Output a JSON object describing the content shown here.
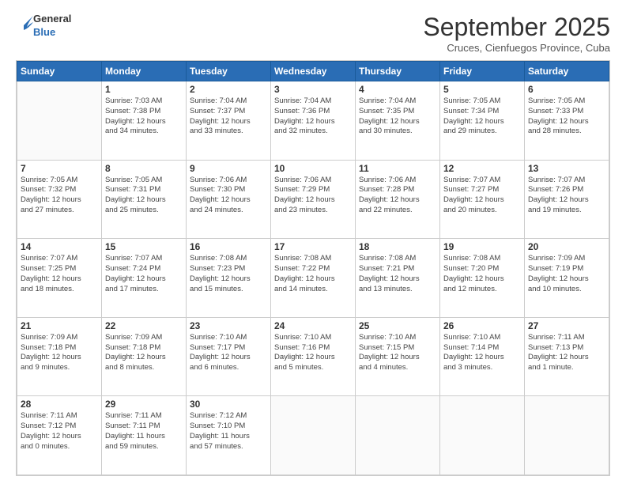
{
  "logo": {
    "line1": "General",
    "line2": "Blue"
  },
  "header": {
    "month_title": "September 2025",
    "subtitle": "Cruces, Cienfuegos Province, Cuba"
  },
  "weekdays": [
    "Sunday",
    "Monday",
    "Tuesday",
    "Wednesday",
    "Thursday",
    "Friday",
    "Saturday"
  ],
  "weeks": [
    [
      {
        "day": "",
        "info": ""
      },
      {
        "day": "1",
        "info": "Sunrise: 7:03 AM\nSunset: 7:38 PM\nDaylight: 12 hours\nand 34 minutes."
      },
      {
        "day": "2",
        "info": "Sunrise: 7:04 AM\nSunset: 7:37 PM\nDaylight: 12 hours\nand 33 minutes."
      },
      {
        "day": "3",
        "info": "Sunrise: 7:04 AM\nSunset: 7:36 PM\nDaylight: 12 hours\nand 32 minutes."
      },
      {
        "day": "4",
        "info": "Sunrise: 7:04 AM\nSunset: 7:35 PM\nDaylight: 12 hours\nand 30 minutes."
      },
      {
        "day": "5",
        "info": "Sunrise: 7:05 AM\nSunset: 7:34 PM\nDaylight: 12 hours\nand 29 minutes."
      },
      {
        "day": "6",
        "info": "Sunrise: 7:05 AM\nSunset: 7:33 PM\nDaylight: 12 hours\nand 28 minutes."
      }
    ],
    [
      {
        "day": "7",
        "info": "Sunrise: 7:05 AM\nSunset: 7:32 PM\nDaylight: 12 hours\nand 27 minutes."
      },
      {
        "day": "8",
        "info": "Sunrise: 7:05 AM\nSunset: 7:31 PM\nDaylight: 12 hours\nand 25 minutes."
      },
      {
        "day": "9",
        "info": "Sunrise: 7:06 AM\nSunset: 7:30 PM\nDaylight: 12 hours\nand 24 minutes."
      },
      {
        "day": "10",
        "info": "Sunrise: 7:06 AM\nSunset: 7:29 PM\nDaylight: 12 hours\nand 23 minutes."
      },
      {
        "day": "11",
        "info": "Sunrise: 7:06 AM\nSunset: 7:28 PM\nDaylight: 12 hours\nand 22 minutes."
      },
      {
        "day": "12",
        "info": "Sunrise: 7:07 AM\nSunset: 7:27 PM\nDaylight: 12 hours\nand 20 minutes."
      },
      {
        "day": "13",
        "info": "Sunrise: 7:07 AM\nSunset: 7:26 PM\nDaylight: 12 hours\nand 19 minutes."
      }
    ],
    [
      {
        "day": "14",
        "info": "Sunrise: 7:07 AM\nSunset: 7:25 PM\nDaylight: 12 hours\nand 18 minutes."
      },
      {
        "day": "15",
        "info": "Sunrise: 7:07 AM\nSunset: 7:24 PM\nDaylight: 12 hours\nand 17 minutes."
      },
      {
        "day": "16",
        "info": "Sunrise: 7:08 AM\nSunset: 7:23 PM\nDaylight: 12 hours\nand 15 minutes."
      },
      {
        "day": "17",
        "info": "Sunrise: 7:08 AM\nSunset: 7:22 PM\nDaylight: 12 hours\nand 14 minutes."
      },
      {
        "day": "18",
        "info": "Sunrise: 7:08 AM\nSunset: 7:21 PM\nDaylight: 12 hours\nand 13 minutes."
      },
      {
        "day": "19",
        "info": "Sunrise: 7:08 AM\nSunset: 7:20 PM\nDaylight: 12 hours\nand 12 minutes."
      },
      {
        "day": "20",
        "info": "Sunrise: 7:09 AM\nSunset: 7:19 PM\nDaylight: 12 hours\nand 10 minutes."
      }
    ],
    [
      {
        "day": "21",
        "info": "Sunrise: 7:09 AM\nSunset: 7:18 PM\nDaylight: 12 hours\nand 9 minutes."
      },
      {
        "day": "22",
        "info": "Sunrise: 7:09 AM\nSunset: 7:18 PM\nDaylight: 12 hours\nand 8 minutes."
      },
      {
        "day": "23",
        "info": "Sunrise: 7:10 AM\nSunset: 7:17 PM\nDaylight: 12 hours\nand 6 minutes."
      },
      {
        "day": "24",
        "info": "Sunrise: 7:10 AM\nSunset: 7:16 PM\nDaylight: 12 hours\nand 5 minutes."
      },
      {
        "day": "25",
        "info": "Sunrise: 7:10 AM\nSunset: 7:15 PM\nDaylight: 12 hours\nand 4 minutes."
      },
      {
        "day": "26",
        "info": "Sunrise: 7:10 AM\nSunset: 7:14 PM\nDaylight: 12 hours\nand 3 minutes."
      },
      {
        "day": "27",
        "info": "Sunrise: 7:11 AM\nSunset: 7:13 PM\nDaylight: 12 hours\nand 1 minute."
      }
    ],
    [
      {
        "day": "28",
        "info": "Sunrise: 7:11 AM\nSunset: 7:12 PM\nDaylight: 12 hours\nand 0 minutes."
      },
      {
        "day": "29",
        "info": "Sunrise: 7:11 AM\nSunset: 7:11 PM\nDaylight: 11 hours\nand 59 minutes."
      },
      {
        "day": "30",
        "info": "Sunrise: 7:12 AM\nSunset: 7:10 PM\nDaylight: 11 hours\nand 57 minutes."
      },
      {
        "day": "",
        "info": ""
      },
      {
        "day": "",
        "info": ""
      },
      {
        "day": "",
        "info": ""
      },
      {
        "day": "",
        "info": ""
      }
    ]
  ]
}
